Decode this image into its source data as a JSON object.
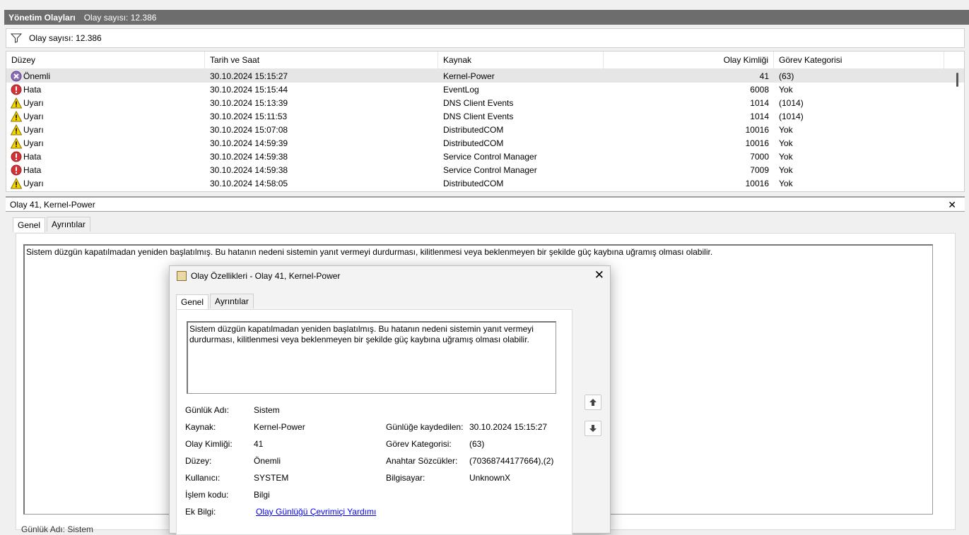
{
  "header": {
    "title": "Yönetim Olayları",
    "count": "Olay sayısı: 12.386"
  },
  "filter": {
    "count": "Olay sayısı: 12.386"
  },
  "columns": [
    "Düzey",
    "Tarih ve Saat",
    "Kaynak",
    "Olay Kimliği",
    "Görev Kategorisi"
  ],
  "rows": [
    {
      "level": "Önemli",
      "icon": "critical-icon",
      "date": "30.10.2024 15:15:27",
      "source": "Kernel-Power",
      "id": "41",
      "category": "(63)"
    },
    {
      "level": "Hata",
      "icon": "error-icon",
      "date": "30.10.2024 15:15:44",
      "source": "EventLog",
      "id": "6008",
      "category": "Yok"
    },
    {
      "level": "Uyarı",
      "icon": "warning-icon",
      "date": "30.10.2024 15:13:39",
      "source": "DNS Client Events",
      "id": "1014",
      "category": "(1014)"
    },
    {
      "level": "Uyarı",
      "icon": "warning-icon",
      "date": "30.10.2024 15:11:53",
      "source": "DNS Client Events",
      "id": "1014",
      "category": "(1014)"
    },
    {
      "level": "Uyarı",
      "icon": "warning-icon",
      "date": "30.10.2024 15:07:08",
      "source": "DistributedCOM",
      "id": "10016",
      "category": "Yok"
    },
    {
      "level": "Uyarı",
      "icon": "warning-icon",
      "date": "30.10.2024 14:59:39",
      "source": "DistributedCOM",
      "id": "10016",
      "category": "Yok"
    },
    {
      "level": "Hata",
      "icon": "error-icon",
      "date": "30.10.2024 14:59:38",
      "source": "Service Control Manager",
      "id": "7000",
      "category": "Yok"
    },
    {
      "level": "Hata",
      "icon": "error-icon",
      "date": "30.10.2024 14:59:38",
      "source": "Service Control Manager",
      "id": "7009",
      "category": "Yok"
    },
    {
      "level": "Uyarı",
      "icon": "warning-icon",
      "date": "30.10.2024 14:58:05",
      "source": "DistributedCOM",
      "id": "10016",
      "category": "Yok"
    }
  ],
  "detail": {
    "title": "Olay 41, Kernel-Power",
    "tabs": [
      "Genel",
      "Ayrıntılar"
    ],
    "description": "Sistem düzgün kapatılmadan yeniden başlatılmış. Bu hatanın nedeni sistemin yanıt vermeyi durdurması, kilitlenmesi veya beklenmeyen bir şekilde güç kaybına uğramış olması olabilir.",
    "bottom_cut": "Günlük Adı:     Sistem"
  },
  "dialog": {
    "title": "Olay Özellikleri - Olay 41, Kernel-Power",
    "tabs": [
      "Genel",
      "Ayrıntılar"
    ],
    "description_line1": "Sistem düzgün kapatılmadan yeniden başlatılmış. Bu hatanın nedeni sistemin yanıt vermeyi",
    "description_line2": "durdurması, kilitlenmesi veya beklenmeyen bir şekilde güç kaybına uğramış olması olabilir.",
    "props_left": [
      {
        "label": "Günlük Adı:",
        "value": "Sistem"
      },
      {
        "label": "Kaynak:",
        "value": "Kernel-Power"
      },
      {
        "label": "Olay Kimliği:",
        "value": "41"
      },
      {
        "label": "Düzey:",
        "value": "Önemli"
      },
      {
        "label": "Kullanıcı:",
        "value": "SYSTEM"
      },
      {
        "label": "İşlem kodu:",
        "value": "Bilgi"
      },
      {
        "label": "Ek Bilgi:",
        "value": "Olay Günlüğü Çevrimiçi Yardımı"
      }
    ],
    "props_right": [
      {
        "label": "Günlüğe kaydedilen:",
        "value": "30.10.2024 15:15:27"
      },
      {
        "label": "Görev Kategorisi:",
        "value": "(63)"
      },
      {
        "label": "Anahtar Sözcükler:",
        "value": "(70368744177664),(2)"
      },
      {
        "label": "Bilgisayar:",
        "value": "UnknownX"
      }
    ]
  }
}
